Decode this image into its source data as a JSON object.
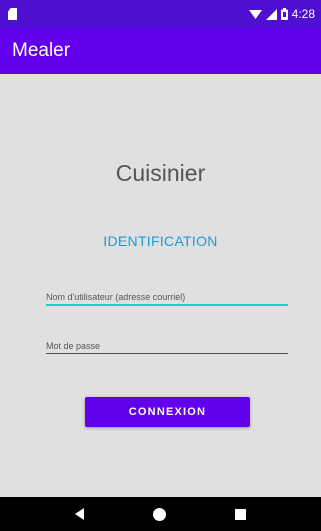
{
  "colors": {
    "status_bg": "#4e0fd1",
    "primary": "#6200ee",
    "accent": "#03dac5",
    "accent_text": "#1e9bd7"
  },
  "status_bar": {
    "time": "4:28",
    "icons": [
      "sd-card-icon",
      "wifi-icon",
      "signal-icon",
      "battery-icon"
    ]
  },
  "app_bar": {
    "title": "Mealer"
  },
  "main": {
    "title": "Cuisinier",
    "section_title": "IDENTIFICATION",
    "username_placeholder": "Nom d'utilisateur (adresse courriel)",
    "username_value": "",
    "password_placeholder": "Mot de passe",
    "password_value": "",
    "login_label": "CONNEXION"
  },
  "nav_bar": {
    "icons": [
      "back-icon",
      "home-icon",
      "recents-icon"
    ]
  }
}
